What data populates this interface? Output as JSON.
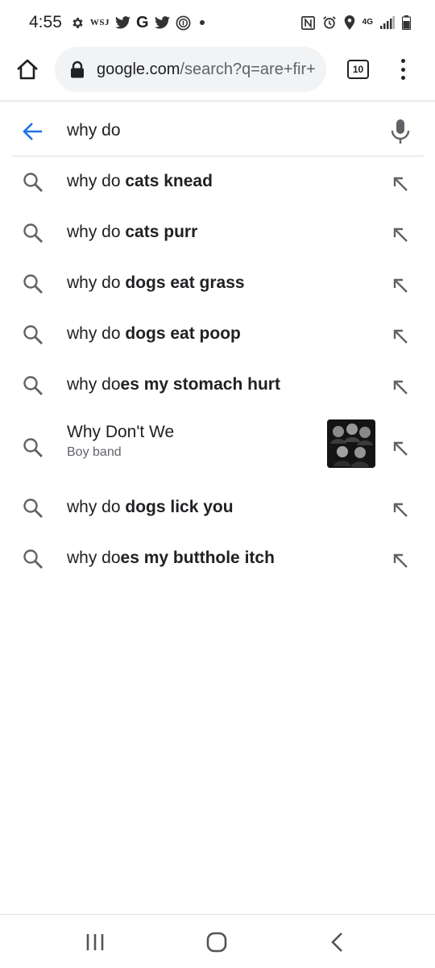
{
  "status_bar": {
    "time": "4:55",
    "wsj": "WSJ",
    "g": "G",
    "network": "4G"
  },
  "address_bar": {
    "url_domain": "google.com",
    "url_path": "/search?q=are+fir+",
    "tab_count": "10"
  },
  "search": {
    "query": "why do"
  },
  "suggestions": [
    {
      "prefix": "why do ",
      "bold": "cats knead"
    },
    {
      "prefix": "why do ",
      "bold": "cats purr"
    },
    {
      "prefix": "why do ",
      "bold": "dogs eat grass"
    },
    {
      "prefix": "why do ",
      "bold": "dogs eat poop"
    },
    {
      "prefix": "why do",
      "bold": "es my stomach hurt"
    }
  ],
  "entity": {
    "title": "Why Don't We",
    "subtitle": "Boy band"
  },
  "suggestions_after": [
    {
      "prefix": "why do ",
      "bold": "dogs lick you"
    },
    {
      "prefix": "why do",
      "bold": "es my butthole itch"
    }
  ],
  "colors": {
    "accent_blue": "#1a73e8",
    "icon_gray": "#5f6368",
    "url_bg": "#f1f3f4"
  }
}
